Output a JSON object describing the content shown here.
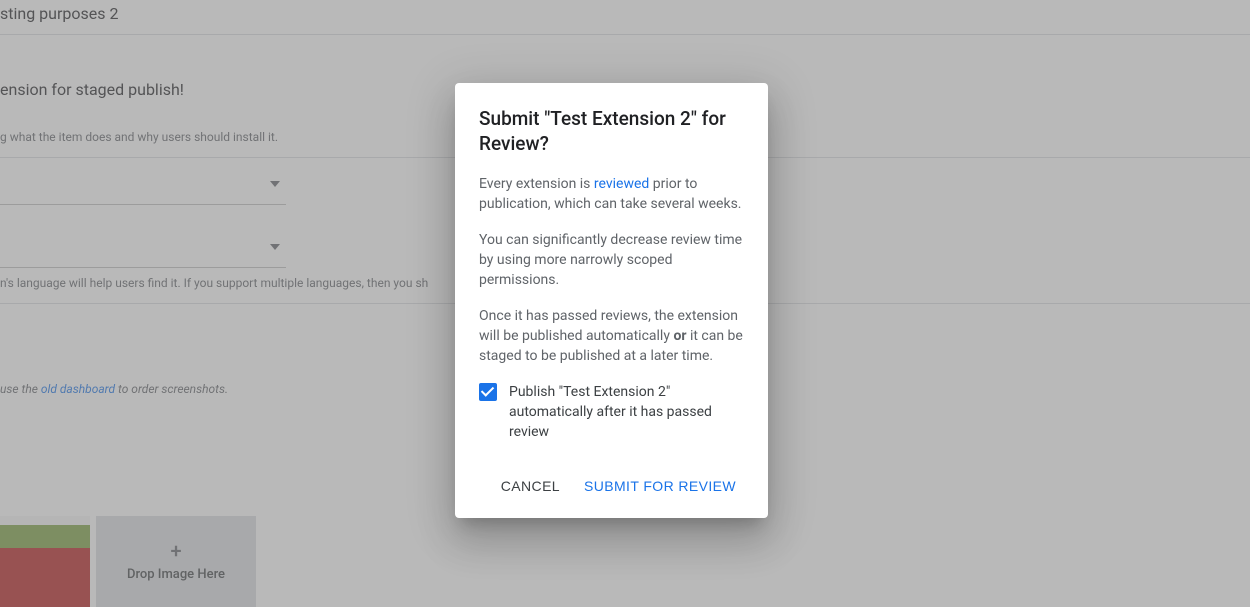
{
  "background": {
    "title_fragment": "sting purposes 2",
    "staged_heading": "ension for staged publish!",
    "desc_helper": "g what the item does and why users should install it.",
    "lang_helper_prefix": "n's language will help users find it. If you support multiple languages, then you sh",
    "screenshot_helper_prefix": "use the ",
    "old_dashboard_link": "old dashboard",
    "screenshot_helper_suffix": " to order screenshots.",
    "drop_image_label": "Drop Image Here"
  },
  "modal": {
    "title": "Submit \"Test Extension 2\" for Review?",
    "p1_prefix": "Every extension is ",
    "p1_link": "reviewed",
    "p1_suffix": " prior to publication, which can take several weeks.",
    "p2": "You can significantly decrease review time by using more narrowly scoped permissions.",
    "p3_prefix": "Once it has passed reviews, the extension will be published automatically ",
    "p3_bold": "or",
    "p3_suffix": " it can be staged to be published at a later time.",
    "checkbox_label": "Publish \"Test Extension 2\" automatically after it has passed review",
    "checkbox_checked": true,
    "cancel_label": "Cancel",
    "submit_label": "Submit for Review"
  }
}
